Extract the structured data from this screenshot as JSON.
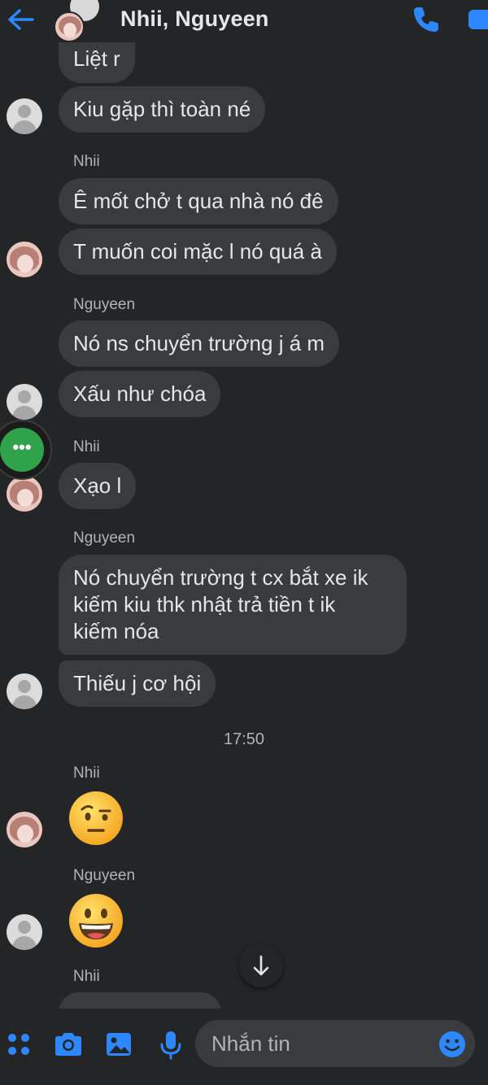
{
  "header": {
    "title": "Nhii, Nguyeen"
  },
  "messages": [
    {
      "text": "Liệt r"
    },
    {
      "text": "Kiu gặp thì toàn né"
    },
    {
      "sender": "Nhii"
    },
    {
      "text": "Ê mốt chở t qua nhà nó đê"
    },
    {
      "text": "T muốn coi mặc l nó quá à"
    },
    {
      "sender": "Nguyeen"
    },
    {
      "text": "Nó ns chuyển trường j á m"
    },
    {
      "text": "Xấu như chóa"
    },
    {
      "sender": "Nhii"
    },
    {
      "text": "Xạo l"
    },
    {
      "sender": "Nguyeen"
    },
    {
      "line1": "Nó chuyển trường t cx bắt xe ik",
      "line2": "kiếm kiu thk nhật trả tiền t ik",
      "line3": "kiếm nóa"
    },
    {
      "text": "Thiếu j cơ hội"
    }
  ],
  "timestamp": "17:50",
  "after": {
    "sender1": "Nhii",
    "sender2": "Nguyeen",
    "sender3": "Nhii"
  },
  "composer": {
    "placeholder": "Nhắn tin"
  },
  "colors": {
    "accent": "#2d88ff",
    "bubble": "#3a3b3c",
    "background": "#242526",
    "chat_head": "#31a24c"
  },
  "icons": {
    "back": "arrow-left-icon",
    "call": "phone-icon",
    "video": "video-icon",
    "apps": "grid-dots-icon",
    "camera": "camera-icon",
    "gallery": "image-icon",
    "mic": "microphone-icon",
    "emoji": "smile-icon",
    "scroll": "arrow-down-icon"
  }
}
